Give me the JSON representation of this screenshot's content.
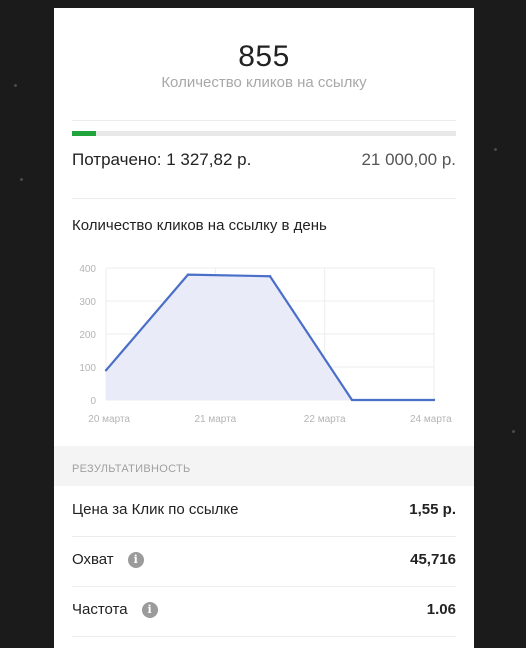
{
  "summary": {
    "clicks_value": "855",
    "clicks_caption": "Количество кликов на ссылку",
    "progress_fraction": 0.063,
    "spent_label": "Потрачено: 1 327,82 р.",
    "budget": "21 000,00 р."
  },
  "colors": {
    "progress": "#20a43c",
    "line": "#4a6fc9",
    "area": "#e9ecf8"
  },
  "chart_data": {
    "type": "area",
    "title": "Количество кликов на ссылку в день",
    "x": [
      "20 марта",
      "20.75",
      "21.5",
      "22.25",
      "24 марта"
    ],
    "x_numeric": [
      0,
      0.75,
      1.5,
      2.25,
      3.0
    ],
    "values": [
      90,
      380,
      375,
      0,
      0
    ],
    "x_tick_labels": [
      "20 марта",
      "21 марта",
      "22 марта",
      "24 марта"
    ],
    "y_ticks": [
      0,
      100,
      200,
      300,
      400
    ],
    "ylim": [
      0,
      400
    ],
    "grid": true
  },
  "performance": {
    "header": "РЕЗУЛЬТАТИВНОСТЬ",
    "rows": [
      {
        "label": "Цена за Клик по ссылке",
        "value": "1,55 р.",
        "info": false
      },
      {
        "label": "Охват",
        "value": "45,716",
        "info": true
      },
      {
        "label": "Частота",
        "value": "1.06",
        "info": true
      }
    ],
    "info_glyph": "i"
  }
}
